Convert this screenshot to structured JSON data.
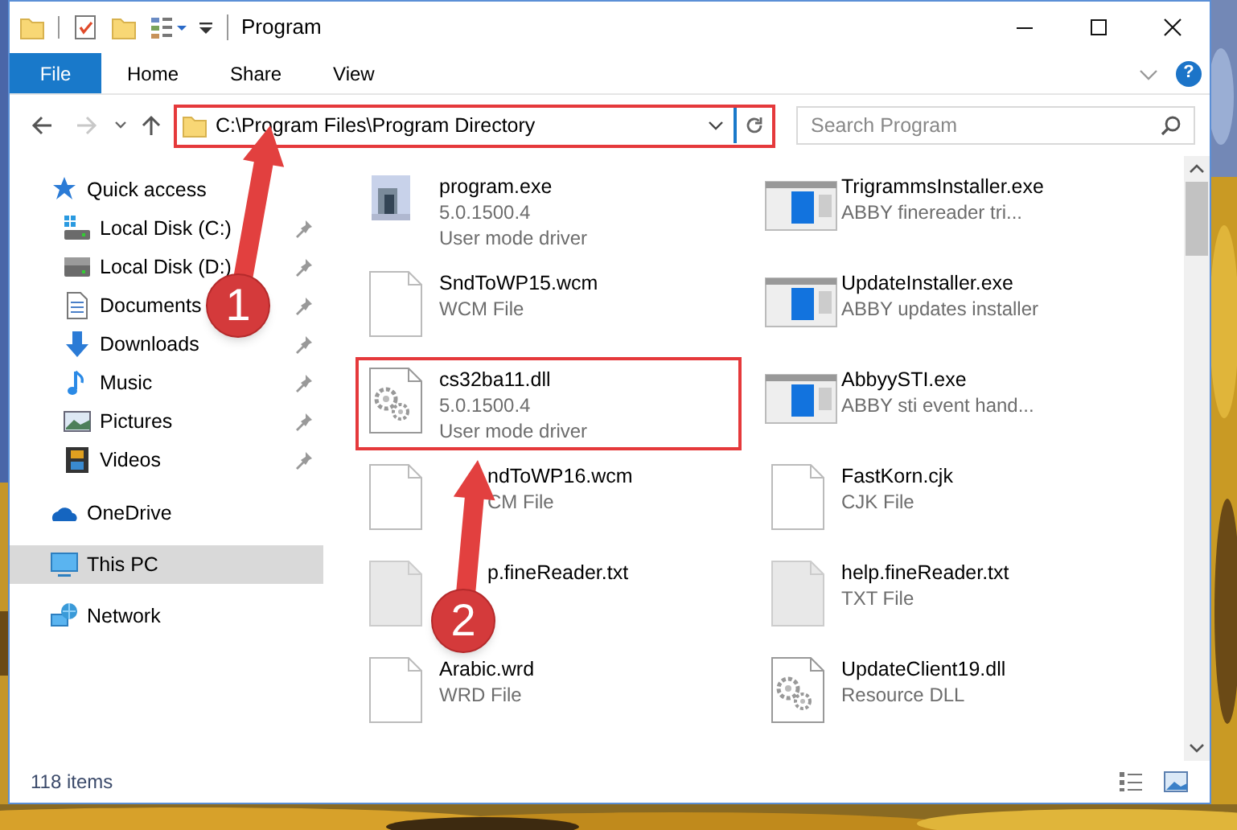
{
  "window": {
    "title": "Program",
    "help": "?"
  },
  "ribbon": {
    "file_tab": "File",
    "tabs": [
      "Home",
      "Share",
      "View"
    ]
  },
  "navigation": {
    "back_disabled": false,
    "forward_disabled": true
  },
  "address": {
    "path": "C:\\Program Files\\Program Directory",
    "highlighted": true
  },
  "search": {
    "placeholder": "Search Program"
  },
  "sidebar": {
    "items": [
      {
        "label": "Quick access",
        "kind": "star",
        "selected": false,
        "children": [
          {
            "label": "Local Disk (C:)",
            "kind": "drive-windows",
            "pinned": true,
            "selected": false
          },
          {
            "label": "Local Disk (D:)",
            "kind": "drive",
            "pinned": true,
            "selected": false
          },
          {
            "label": "Documents",
            "kind": "document",
            "pinned": true,
            "selected": false
          },
          {
            "label": "Downloads",
            "kind": "download",
            "pinned": true,
            "selected": false
          },
          {
            "label": "Music",
            "kind": "music",
            "pinned": true,
            "selected": false
          },
          {
            "label": "Pictures",
            "kind": "pictures",
            "pinned": true,
            "selected": false
          },
          {
            "label": "Videos",
            "kind": "videos",
            "pinned": true,
            "selected": false
          }
        ]
      },
      {
        "label": "OneDrive",
        "kind": "cloud",
        "selected": false
      },
      {
        "label": "This PC",
        "kind": "computer",
        "selected": true
      },
      {
        "label": "Network",
        "kind": "network",
        "selected": false
      }
    ]
  },
  "files": [
    {
      "name": "program.exe",
      "lines": [
        "5.0.1500.4",
        "User mode driver"
      ],
      "kind": "program",
      "highlighted": false,
      "covered": false
    },
    {
      "name": "TrigrammsInstaller.exe",
      "lines": [
        "ABBY finereader tri..."
      ],
      "kind": "app",
      "highlighted": false,
      "covered": false
    },
    {
      "name": "SndToWP15.wcm",
      "lines": [
        "WCM File"
      ],
      "kind": "page",
      "highlighted": false,
      "covered": false
    },
    {
      "name": "UpdateInstaller.exe",
      "lines": [
        "ABBY updates installer"
      ],
      "kind": "app",
      "highlighted": false,
      "covered": false
    },
    {
      "name": "cs32ba11.dll",
      "lines": [
        "5.0.1500.4",
        "User mode driver"
      ],
      "kind": "gear-page",
      "highlighted": true,
      "covered": false
    },
    {
      "name": "AbbyySTI.exe",
      "lines": [
        "ABBY sti event hand..."
      ],
      "kind": "app",
      "highlighted": false,
      "covered": false
    },
    {
      "name": "ndToWP16.wcm",
      "lines": [
        "CM File"
      ],
      "kind": "page",
      "highlighted": false,
      "covered": true
    },
    {
      "name": "FastKorn.cjk",
      "lines": [
        "CJK File"
      ],
      "kind": "page",
      "highlighted": false,
      "covered": false
    },
    {
      "name": "p.fineReader.txt",
      "kind": "text-page",
      "highlighted": false,
      "covered": true
    },
    {
      "name": "help.fineReader.txt",
      "lines": [
        "TXT File"
      ],
      "kind": "text-page",
      "highlighted": false,
      "covered": false
    },
    {
      "name": "Arabic.wrd",
      "lines": [
        "WRD File"
      ],
      "kind": "page",
      "highlighted": false,
      "covered": false
    },
    {
      "name": "UpdateClient19.dll",
      "lines": [
        "Resource DLL"
      ],
      "kind": "gear-page",
      "highlighted": false,
      "covered": false
    }
  ],
  "status_bar": {
    "item_count": "118 items"
  },
  "annotations": [
    {
      "label": "1"
    },
    {
      "label": "2"
    }
  ]
}
